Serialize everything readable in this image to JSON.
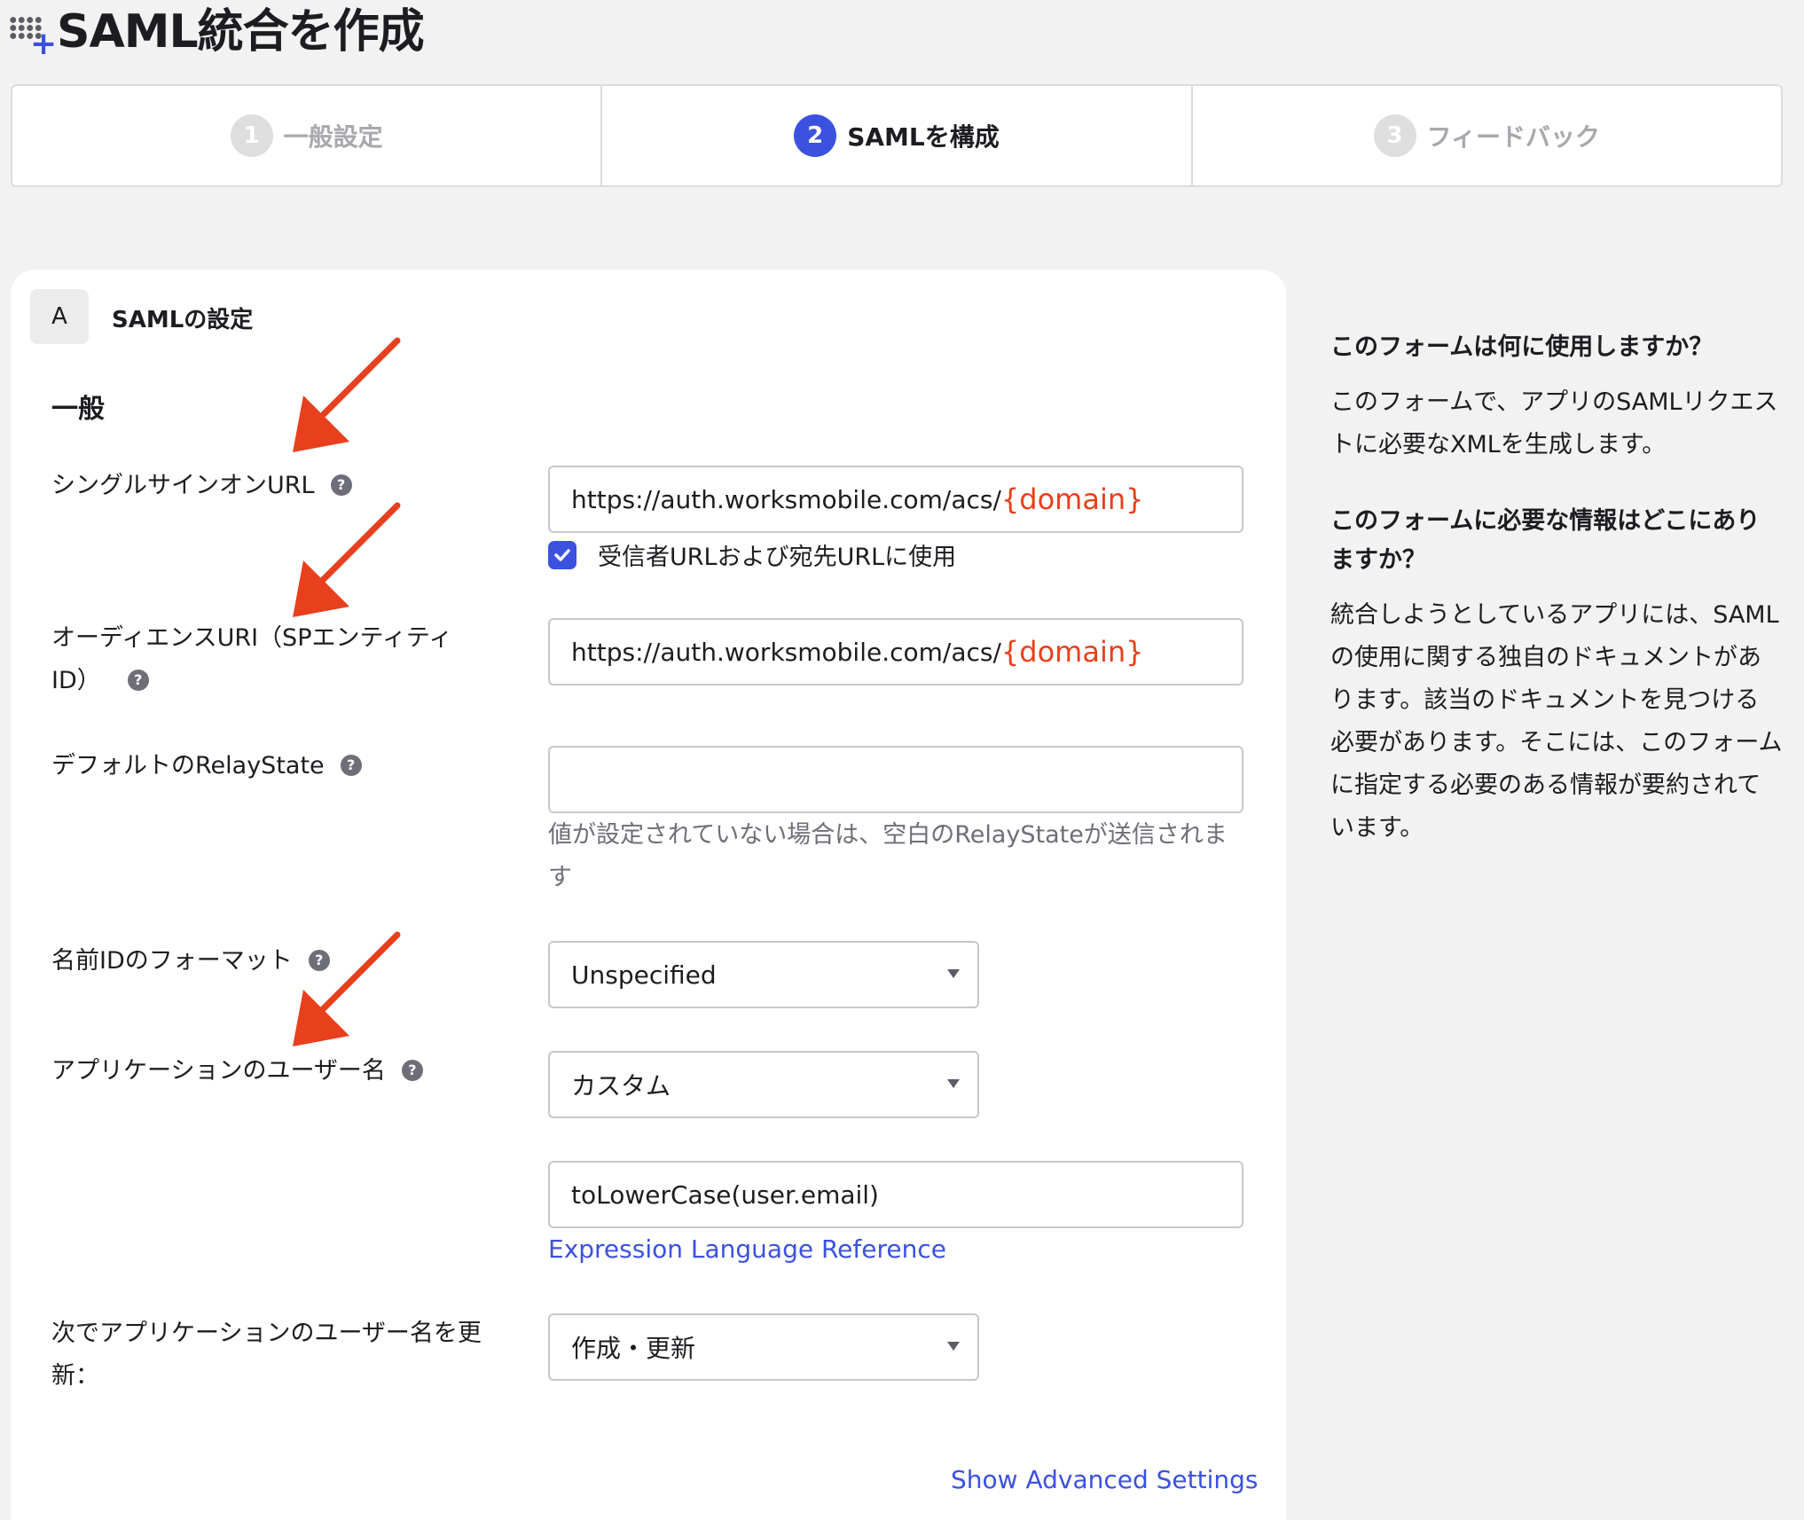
{
  "header": {
    "title": "SAML統合を作成"
  },
  "steps": [
    {
      "number": "1",
      "label": "一般設定",
      "state": "inactive"
    },
    {
      "number": "2",
      "label": "SAMLを構成",
      "state": "active"
    },
    {
      "number": "3",
      "label": "フィードバック",
      "state": "inactive"
    }
  ],
  "section": {
    "badge": "A",
    "title": "SAMLの設定",
    "group_title": "一般"
  },
  "fields": {
    "sso_url": {
      "label": "シングルサインオンURL",
      "value_prefix": "https://auth.worksmobile.com/acs/",
      "value_token": "{domain}",
      "checkbox_label": "受信者URLおよび宛先URLに使用",
      "checkbox_checked": true
    },
    "audience_uri": {
      "label_line1": "オーディエンスURI（SPエンティティ",
      "label_line2": "ID）",
      "value_prefix": "https://auth.worksmobile.com/acs/",
      "value_token": "{domain}"
    },
    "relay_state": {
      "label": "デフォルトのRelayState",
      "value": "",
      "hint": "値が設定されていない場合は、空白のRelayStateが送信されます"
    },
    "name_id_format": {
      "label": "名前IDのフォーマット",
      "selected": "Unspecified"
    },
    "app_username": {
      "label": "アプリケーションのユーザー名",
      "selected": "カスタム",
      "expression": "toLowerCase(user.email)",
      "link": "Expression Language Reference"
    },
    "update_username": {
      "label_line1": "次でアプリケーションのユーザー名を更",
      "label_line2": "新：",
      "selected": "作成・更新"
    }
  },
  "advanced_link": "Show Advanced Settings",
  "sidebar": {
    "q1": "このフォームは何に使用しますか？",
    "a1": "このフォームで、アプリのSAMLリクエストに必要なXMLを生成します。",
    "q2": "このフォームに必要な情報はどこにありますか？",
    "a2": "統合しようとしているアプリには、SAMLの使用に関する独自のドキュメントがあります。該当のドキュメントを見つける必要があります。そこには、このフォームに指定する必要のある情報が要約されています。"
  },
  "colors": {
    "accent": "#3b51e0",
    "annotation_arrow": "#e8401c",
    "domain_token": "#e8401c",
    "page_bg": "#f2f2f2"
  },
  "icons": {
    "app": "grid-plus-icon",
    "help": "question-circle-icon",
    "check": "check-icon",
    "caret": "caret-down-icon",
    "annotation": "red-arrow-icon"
  }
}
